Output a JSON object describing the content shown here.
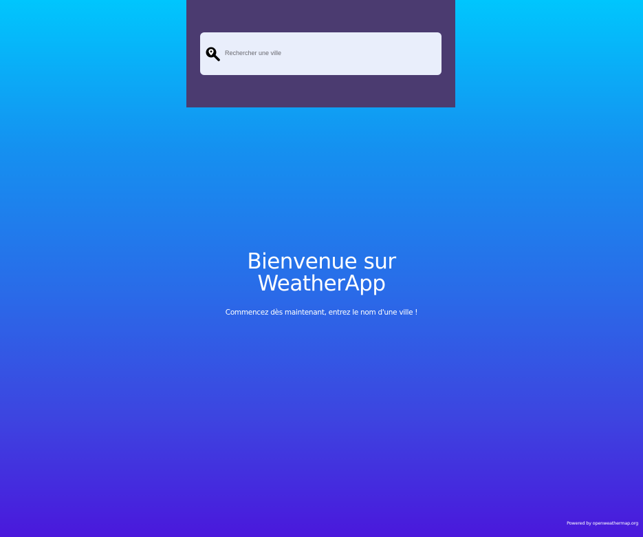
{
  "search": {
    "placeholder": "Rechercher une ville",
    "icon": "location-search-icon"
  },
  "welcome": {
    "title": "Bienvenue sur WeatherApp",
    "subtitle": "Commencez dès maintenant, entrez le nom d'une ville !"
  },
  "footer": {
    "credit": "Powered by openweathermap.org"
  },
  "colors": {
    "panel": "#4b3b70",
    "search_box": "#e9eefb",
    "gradient_top": "#00c6fd",
    "gradient_bottom": "#4a18dc"
  }
}
